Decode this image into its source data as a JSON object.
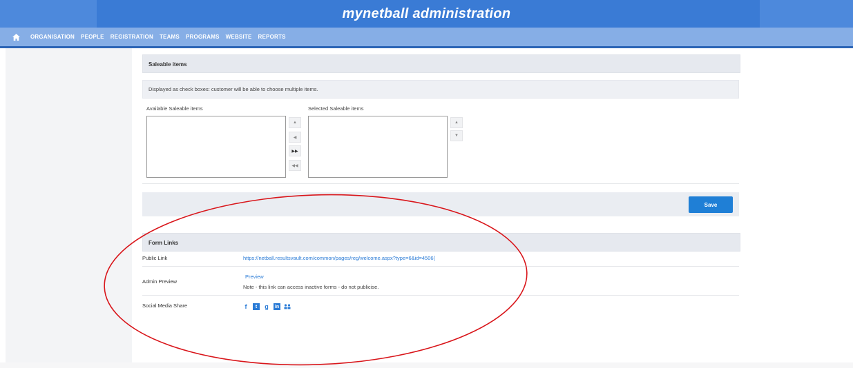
{
  "header": {
    "title": "mynetball administration"
  },
  "nav": {
    "items": [
      "ORGANISATION",
      "PEOPLE",
      "REGISTRATION",
      "TEAMS",
      "PROGRAMS",
      "WEBSITE",
      "REPORTS"
    ],
    "active": "PROGRAMS"
  },
  "saleable": {
    "title": "Saleable items",
    "note": "Displayed as check boxes: customer will be able to choose multiple items.",
    "available_label": "Available Saleable items",
    "selected_label": "Selected Saleable items",
    "move_buttons": [
      "▲",
      "◀",
      "▶▶",
      "◀◀"
    ],
    "order_buttons": [
      "▲",
      "▼"
    ]
  },
  "save_label": "Save",
  "form_links": {
    "title": "Form Links",
    "public_link_label": "Public Link",
    "public_link_url": "https://netball.resultsvault.com/common/pages/reg/welcome.aspx?type=6&id=4506(",
    "admin_preview_label": "Admin Preview",
    "preview_link": "Preview",
    "preview_note": "Note - this link can access inactive forms - do not publicise.",
    "social_label": "Social Media Share",
    "social_icons": [
      "facebook-icon",
      "twitter-icon",
      "google-plus-icon",
      "linkedin-icon",
      "share-icon"
    ]
  },
  "colors": {
    "header_blue": "#3a7bd5",
    "nav_blue": "#86aee6",
    "save_blue": "#1f7fd6",
    "annotation_red": "#d9161b"
  }
}
